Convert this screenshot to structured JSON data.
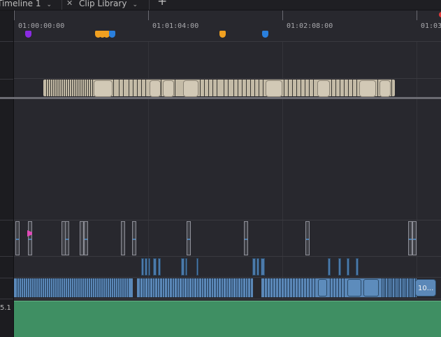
{
  "tabs": [
    {
      "label": "Timeline 1"
    },
    {
      "label": "Clip Library"
    }
  ],
  "icons": {
    "tab_dropdown": "chevron-down-icon",
    "tab_close": "close-icon",
    "new_tab": "plus-icon",
    "playhead": "playhead-icon"
  },
  "ruler": {
    "timecodes": [
      "01:00:00:00",
      "01:01:04:00",
      "01:02:08:00",
      "01:03"
    ]
  },
  "markers": {
    "colors": [
      "#8a2be2",
      "#f0a020",
      "#f0a020",
      "#f0a020",
      "#2a7fdc",
      "#f0a020",
      "#2a7fdc"
    ]
  },
  "tracks": {
    "audio_channel_label": "5.1",
    "clip_label_audio3": "10..."
  },
  "colors": {
    "background": "#28282e",
    "video_clip": "#c4bba7",
    "audio_clip": "#5b88b8",
    "audio_mix": "#3f8f63",
    "playhead": "#e03a3a"
  }
}
